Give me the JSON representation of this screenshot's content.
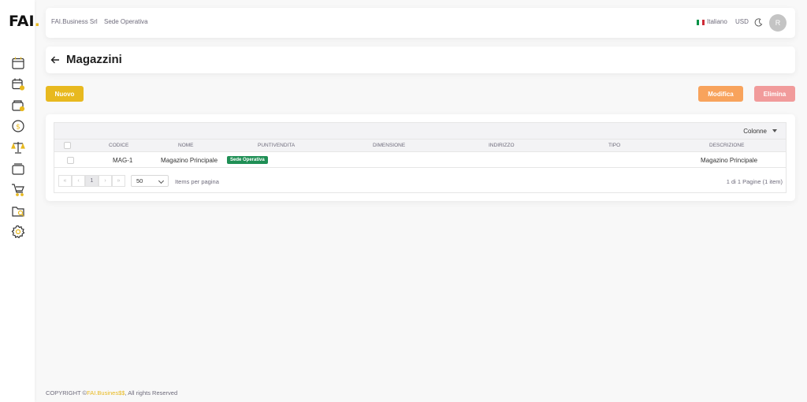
{
  "logo": {
    "text": "FAI",
    "dot": "."
  },
  "sidebar": {
    "icons": [
      "calendar-icon",
      "calendar-user-icon",
      "wallet-icon",
      "dollar-coin-icon",
      "scale-icon",
      "layers-icon",
      "cart-icon",
      "folder-search-icon",
      "gear-icon"
    ]
  },
  "navbar": {
    "company": "FAI.Business Srl",
    "sede": "Sede Operativa",
    "language": "Italiano",
    "currency": "USD",
    "avatar": "R"
  },
  "page": {
    "title": "Magazzini"
  },
  "actions": {
    "new": "Nuovo",
    "edit": "Modifica",
    "delete": "Elimina"
  },
  "grid": {
    "columns_label": "Colonne",
    "headers": [
      "Codice",
      "Nome",
      "Puntivendita",
      "Dimensione",
      "Indirizzo",
      "Tipo",
      "Descrizione"
    ],
    "rows": [
      {
        "codice": "MAG-1",
        "nome": "Magazino Principale",
        "puntivendita": "Sede Operativa",
        "dimensione": "",
        "indirizzo": "",
        "tipo": "",
        "descrizione": "Magazino Principale"
      }
    ],
    "pager": {
      "first": "«",
      "prev": "‹",
      "current": "1",
      "next": "›",
      "last": "»",
      "page_size": "50",
      "items_per_page": "Items per pagina",
      "info": "1 di 1 Pagine (1 item)"
    }
  },
  "footer": {
    "prefix": "COPYRIGHT ©",
    "brand": "FAI.Busines$$",
    "suffix": ", All rights Reserved"
  },
  "colors": {
    "accent": "#e8b91f",
    "edit": "#f8a35c",
    "delete": "#f19b9b",
    "badge": "#1f8f55"
  }
}
